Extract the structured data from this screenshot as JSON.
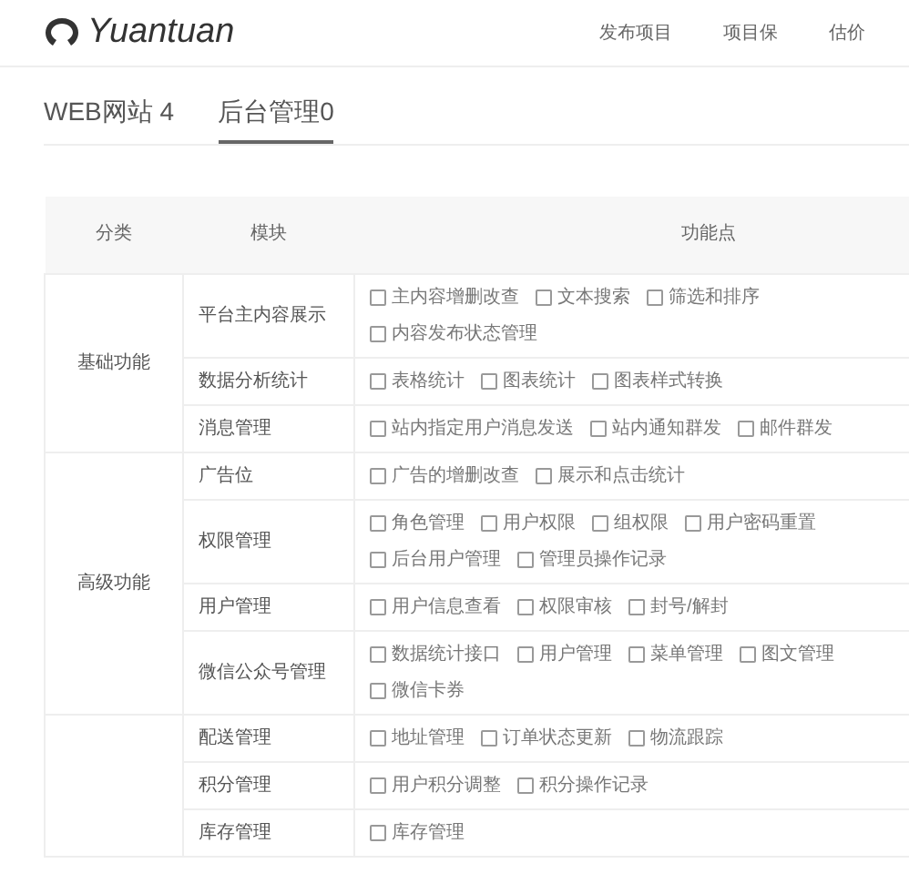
{
  "header": {
    "logo": "Yuantuan",
    "nav": [
      "发布项目",
      "项目保",
      "估价"
    ]
  },
  "tabs": [
    {
      "label": "WEB网站 4",
      "selected": false
    },
    {
      "label": "后台管理0",
      "selected": true
    }
  ],
  "table": {
    "columns": [
      "分类",
      "模块",
      "功能点"
    ],
    "groups": [
      {
        "category": "基础功能",
        "modules": [
          {
            "name": "平台主内容展示",
            "features": [
              {
                "label": "主内容增删改查",
                "checked": false
              },
              {
                "label": "文本搜索",
                "checked": false
              },
              {
                "label": "筛选和排序",
                "checked": false
              },
              {
                "label": "内容发布状态管理",
                "checked": false
              }
            ]
          },
          {
            "name": "数据分析统计",
            "features": [
              {
                "label": "表格统计",
                "checked": false
              },
              {
                "label": "图表统计",
                "checked": false
              },
              {
                "label": "图表样式转换",
                "checked": false
              }
            ]
          },
          {
            "name": "消息管理",
            "features": [
              {
                "label": "站内指定用户消息发送",
                "checked": false
              },
              {
                "label": "站内通知群发",
                "checked": false
              },
              {
                "label": "邮件群发",
                "checked": false
              }
            ]
          }
        ]
      },
      {
        "category": "高级功能",
        "modules": [
          {
            "name": "广告位",
            "features": [
              {
                "label": "广告的增删改查",
                "checked": false
              },
              {
                "label": "展示和点击统计",
                "checked": false
              }
            ]
          },
          {
            "name": "权限管理",
            "features": [
              {
                "label": "角色管理",
                "checked": false
              },
              {
                "label": "用户权限",
                "checked": false
              },
              {
                "label": "组权限",
                "checked": false
              },
              {
                "label": "用户密码重置",
                "checked": false
              },
              {
                "label": "后台用户管理",
                "checked": false
              },
              {
                "label": "管理员操作记录",
                "checked": false
              }
            ]
          },
          {
            "name": "用户管理",
            "features": [
              {
                "label": "用户信息查看",
                "checked": false
              },
              {
                "label": "权限审核",
                "checked": false
              },
              {
                "label": "封号/解封",
                "checked": false
              }
            ]
          },
          {
            "name": "微信公众号管理",
            "features": [
              {
                "label": "数据统计接口",
                "checked": false
              },
              {
                "label": "用户管理",
                "checked": false
              },
              {
                "label": "菜单管理",
                "checked": false
              },
              {
                "label": "图文管理",
                "checked": false
              },
              {
                "label": "微信卡券",
                "checked": false
              }
            ]
          }
        ]
      },
      {
        "modules": [
          {
            "name": "配送管理",
            "features": [
              {
                "label": "地址管理",
                "checked": false
              },
              {
                "label": "订单状态更新",
                "checked": false
              },
              {
                "label": "物流跟踪",
                "checked": false
              }
            ]
          },
          {
            "name": "积分管理",
            "features": [
              {
                "label": "用户积分调整",
                "checked": false
              },
              {
                "label": "积分操作记录",
                "checked": false
              }
            ]
          },
          {
            "name": "库存管理",
            "features": [
              {
                "label": "库存管理",
                "checked": false
              }
            ]
          }
        ]
      }
    ]
  }
}
